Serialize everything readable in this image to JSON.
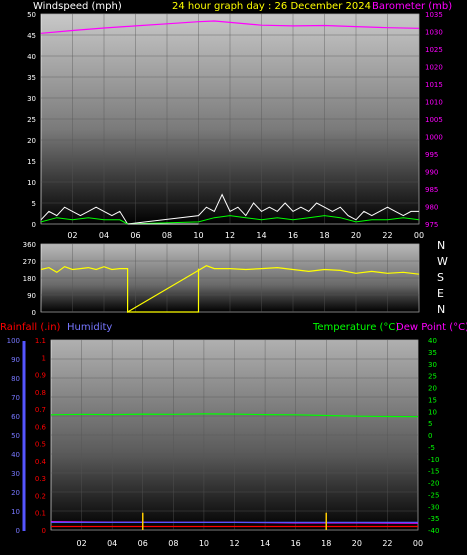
{
  "header": {
    "left_title": "Windspeed (mph)",
    "center_title": "24 hour graph day : 26 December 2024",
    "right_title": "Barometer (mb)"
  },
  "direction_labels": [
    "N",
    "W",
    "S",
    "E",
    "N"
  ],
  "lower_header": {
    "rain_label": "Rainfall (.in)",
    "humidity_label": "Humidity",
    "temp_label": "Temperature (°C)",
    "dew_label": "Dew Point (°C)"
  },
  "colors": {
    "wind": "#ffffff",
    "wind_avg": "#00ff00",
    "barometer": "#ff00ff",
    "direction": "#ffff00",
    "humidity": "#5555ff",
    "rain": "#ff0000",
    "temperature": "#00ff00",
    "dew_point": "#ff00ff",
    "header_center": "#ffff00"
  },
  "chart_data": [
    {
      "type": "line",
      "name": "wind-barometer",
      "xticks": [
        "02",
        "04",
        "06",
        "08",
        "10",
        "12",
        "14",
        "16",
        "18",
        "20",
        "22",
        "00"
      ],
      "ylim_left": [
        0,
        50
      ],
      "yticks_left": [
        "50",
        "45",
        "40",
        "35",
        "30",
        "25",
        "20",
        "15",
        "10",
        "5",
        "0"
      ],
      "ylim_right": [
        975,
        1035
      ],
      "yticks_right": [
        "1035",
        "1030",
        "1025",
        "1020",
        "1015",
        "1010",
        "1005",
        "1000",
        "995",
        "990",
        "985",
        "980",
        "975"
      ],
      "series": [
        {
          "name": "Barometer (mb)",
          "x": [
            0,
            2,
            4,
            6,
            8,
            10,
            11,
            12,
            14,
            16,
            18,
            20,
            22,
            24
          ],
          "values": [
            1029.5,
            1030.3,
            1031.0,
            1031.6,
            1032.2,
            1032.8,
            1033.0,
            1032.6,
            1031.8,
            1031.6,
            1031.7,
            1031.4,
            1031.1,
            1030.9
          ]
        },
        {
          "x": [
            0,
            0.5,
            1,
            1.5,
            2,
            2.5,
            3,
            3.5,
            4,
            4.5,
            5,
            5.5,
            10,
            10.5,
            11,
            11.5,
            12,
            12.5,
            13,
            13.5,
            14,
            14.5,
            15,
            15.5,
            16,
            16.5,
            17,
            17.5,
            18,
            18.5,
            19,
            19.5,
            20,
            20.5,
            21,
            21.5,
            22,
            22.5,
            23,
            23.5,
            24
          ],
          "values": [
            1,
            3,
            2,
            4,
            3,
            2,
            3,
            4,
            3,
            2,
            3,
            0,
            2,
            4,
            3,
            7,
            3,
            4,
            2,
            5,
            3,
            4,
            3,
            5,
            3,
            4,
            3,
            5,
            4,
            3,
            4,
            2,
            1,
            3,
            2,
            3,
            4,
            3,
            2,
            3,
            3
          ]
        },
        {
          "x": [
            0,
            1,
            2,
            3,
            4,
            5,
            5.5,
            10,
            11,
            12,
            13,
            14,
            15,
            16,
            17,
            18,
            19,
            20,
            21,
            22,
            23,
            24
          ],
          "values": [
            0.5,
            1.5,
            1,
            1.5,
            1,
            1,
            0,
            0.5,
            1.5,
            2,
            1.5,
            1,
            1.5,
            1,
            1.5,
            2,
            1.5,
            0.5,
            1,
            1,
            1.5,
            1
          ]
        }
      ]
    },
    {
      "type": "line",
      "name": "wind-direction",
      "ylim": [
        0,
        360
      ],
      "yticks": [
        "360",
        "270",
        "180",
        "90",
        "0"
      ],
      "series": [
        {
          "x": [
            0,
            0.5,
            1,
            1.5,
            2,
            2.5,
            3,
            3.5,
            4,
            4.5,
            5,
            5.5,
            10,
            10.5,
            11,
            12,
            13,
            14,
            15,
            16,
            17,
            18,
            19,
            20,
            21,
            22,
            23,
            24
          ],
          "values": [
            225,
            235,
            210,
            240,
            225,
            230,
            235,
            225,
            240,
            225,
            230,
            0,
            220,
            245,
            230,
            230,
            225,
            230,
            235,
            225,
            215,
            225,
            220,
            205,
            215,
            205,
            210,
            200
          ]
        }
      ]
    },
    {
      "type": "line",
      "name": "humidity-rain-temperature",
      "xticks": [
        "02",
        "04",
        "06",
        "08",
        "10",
        "12",
        "14",
        "16",
        "18",
        "20",
        "22",
        "00"
      ],
      "ylim_humidity": [
        0,
        100
      ],
      "yticks_humidity": [
        "100",
        "90",
        "80",
        "70",
        "60",
        "50",
        "40",
        "30",
        "20",
        "10",
        "0"
      ],
      "ylim_rain": [
        0,
        1.1
      ],
      "yticks_rain": [
        "1.1",
        "1",
        "0.9",
        "0.8",
        "0.7",
        "0.6",
        "0.5",
        "0.4",
        "0.3",
        "0.2",
        "0.1",
        "0"
      ],
      "ylim_temp": [
        -40,
        40
      ],
      "yticks_temp": [
        "40",
        "35",
        "30",
        "25",
        "20",
        "15",
        "10",
        "5",
        "0",
        "-5",
        "-10",
        "-15",
        "-20",
        "-25",
        "-30",
        "-35",
        "-40"
      ],
      "series": [
        {
          "name": "Temperature (°C)",
          "x": [
            0,
            2,
            4,
            6,
            8,
            10,
            12,
            14,
            16,
            18,
            20,
            22,
            24
          ],
          "values": [
            8.5,
            8.7,
            8.6,
            8.8,
            8.7,
            8.9,
            8.8,
            8.6,
            8.5,
            8.2,
            7.9,
            7.8,
            7.7
          ]
        },
        {
          "name": "Dew Point (°C)",
          "x": [
            0,
            4,
            8,
            12,
            16,
            20,
            24
          ],
          "values": [
            -36.5,
            -36.7,
            -36.8,
            -36.8,
            -37.0,
            -37.0,
            -37.1
          ]
        },
        {
          "name": "Rainfall (.in)",
          "x": [
            0,
            24
          ],
          "values": [
            0.02,
            0.02
          ]
        },
        {
          "name": "Humidity",
          "x": [
            0,
            24
          ],
          "values": [
            4,
            4
          ]
        }
      ],
      "rain_spikes": {
        "x": [
          6.0,
          18.0
        ],
        "values": [
          0.1,
          0.1
        ]
      }
    }
  ]
}
